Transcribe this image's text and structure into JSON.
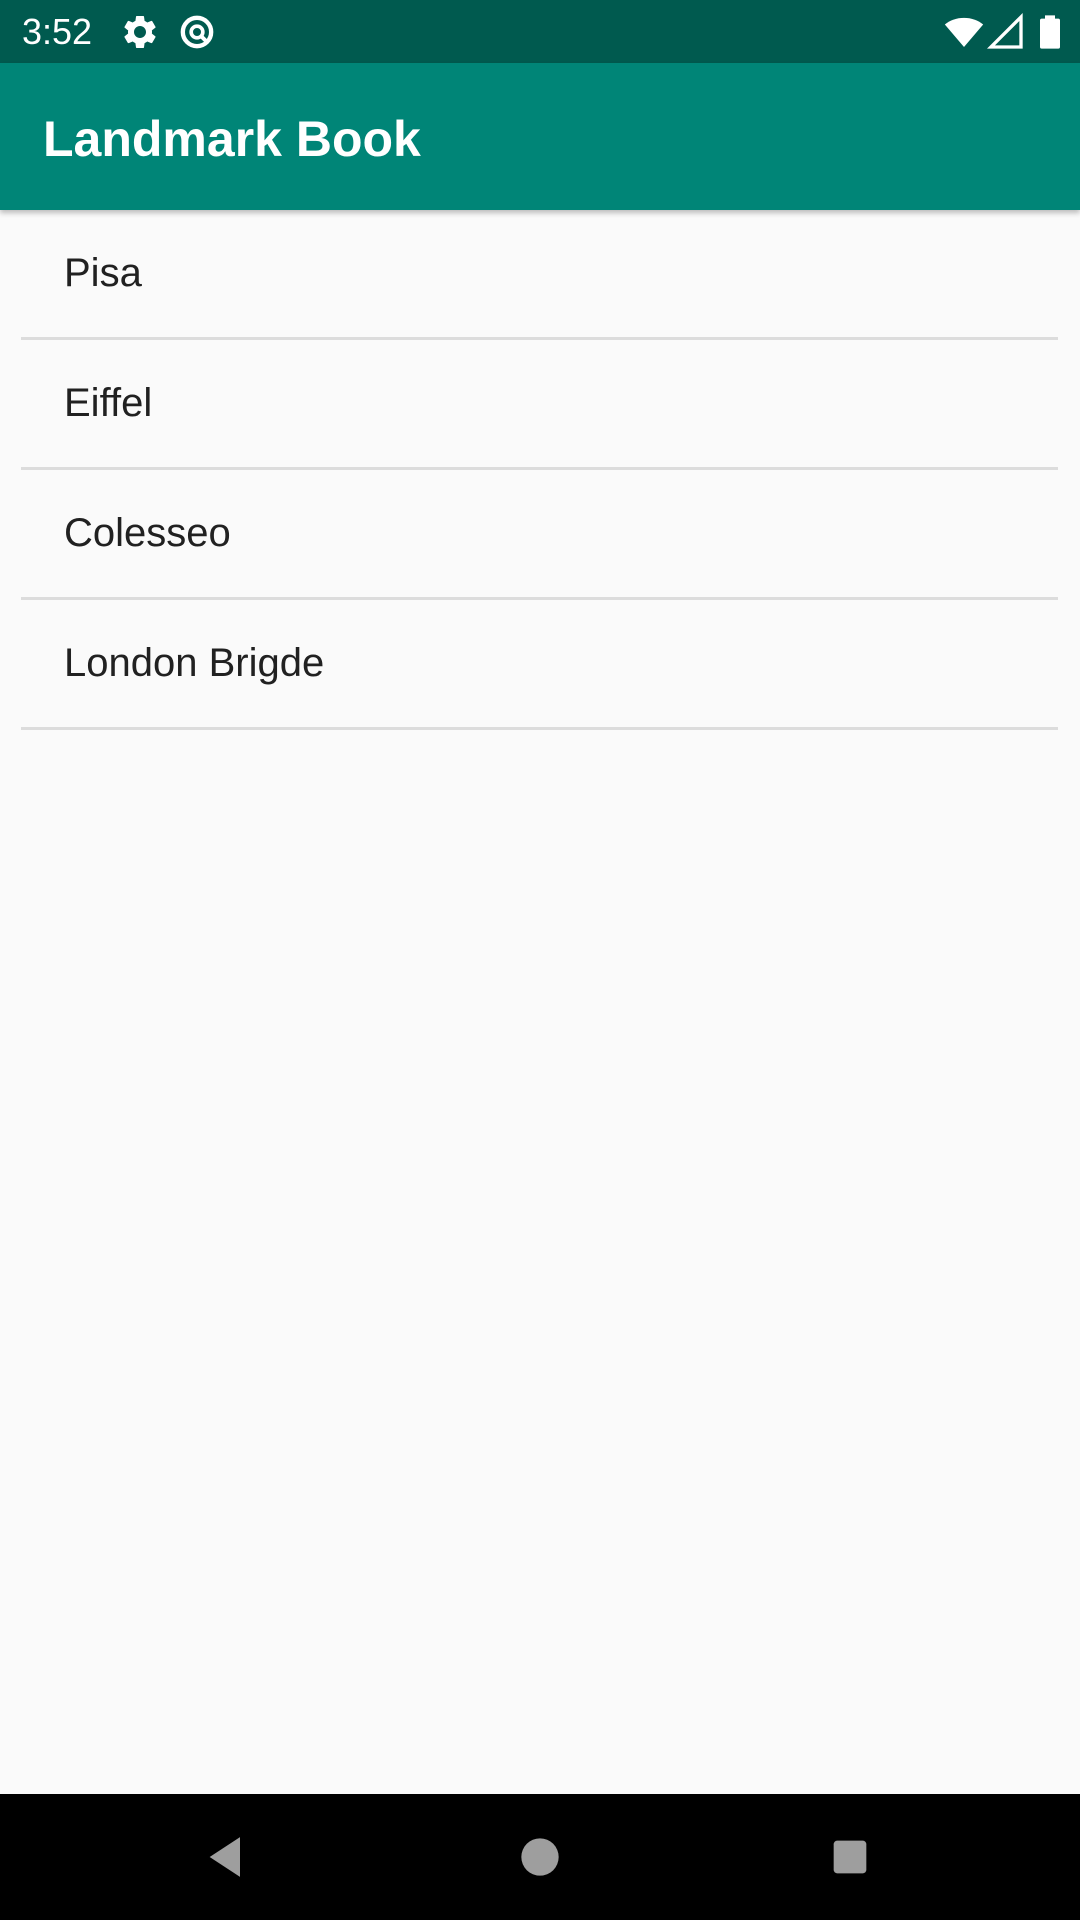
{
  "status_bar": {
    "time": "3:52",
    "icons": [
      "settings-icon",
      "data-saver-icon",
      "wifi-icon",
      "signal-icon",
      "battery-icon"
    ]
  },
  "app_bar": {
    "title": "Landmark Book",
    "color": "#008577"
  },
  "list": {
    "items": [
      {
        "label": "Pisa"
      },
      {
        "label": "Eiffel"
      },
      {
        "label": "Colesseo"
      },
      {
        "label": "London Brigde"
      }
    ]
  },
  "nav_bar": {
    "buttons": [
      "back-icon",
      "home-icon",
      "recents-icon"
    ]
  },
  "colors": {
    "status_bar": "#005a4f",
    "primary": "#008577",
    "background": "#fafafa",
    "divider": "#dcdcdc",
    "text": "#212121"
  }
}
